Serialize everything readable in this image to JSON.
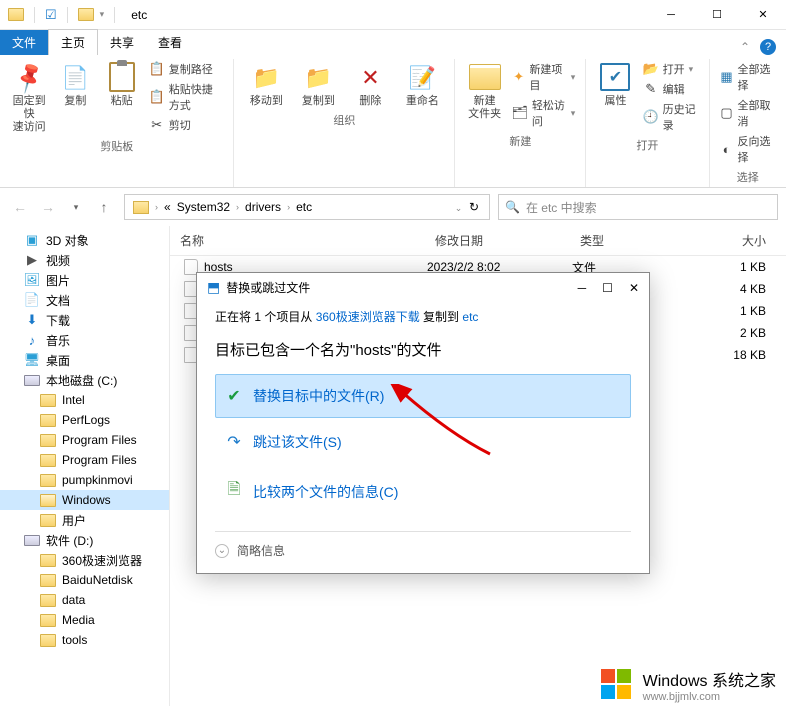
{
  "titlebar": {
    "title": "etc"
  },
  "tabs": {
    "file": "文件",
    "home": "主页",
    "share": "共享",
    "view": "查看"
  },
  "ribbon": {
    "clipboard": {
      "label": "剪贴板",
      "pin": "固定到快\n速访问",
      "copy": "复制",
      "paste": "粘贴",
      "copy_path": "复制路径",
      "paste_shortcut": "粘贴快捷方式",
      "cut": "剪切"
    },
    "organize": {
      "label": "组织",
      "move_to": "移动到",
      "copy_to": "复制到",
      "delete": "删除",
      "rename": "重命名"
    },
    "new": {
      "label": "新建",
      "new_folder": "新建\n文件夹",
      "new_item": "新建项目",
      "easy_access": "轻松访问"
    },
    "open": {
      "label": "打开",
      "properties": "属性",
      "open": "打开",
      "edit": "编辑",
      "history": "历史记录"
    },
    "select": {
      "label": "选择",
      "select_all": "全部选择",
      "select_none": "全部取消",
      "invert": "反向选择"
    }
  },
  "breadcrumb": {
    "items": [
      "System32",
      "drivers",
      "etc"
    ],
    "refresh": "⟳"
  },
  "search": {
    "placeholder": "在 etc 中搜索"
  },
  "tree": {
    "three_d": "3D 对象",
    "videos": "视频",
    "pictures": "图片",
    "documents": "文档",
    "downloads": "下载",
    "music": "音乐",
    "desktop": "桌面",
    "local_c": "本地磁盘 (C:)",
    "intel": "Intel",
    "perflogs": "PerfLogs",
    "program_files": "Program Files",
    "program_files2": "Program Files",
    "pumpkin": "pumpkinmovi",
    "windows": "Windows",
    "users": "用户",
    "soft_d": "软件 (D:)",
    "360": "360极速浏览器",
    "baidu": "BaiduNetdisk",
    "data": "data",
    "media": "Media",
    "tools": "tools"
  },
  "columns": {
    "name": "名称",
    "date": "修改日期",
    "type": "类型",
    "size": "大小"
  },
  "files": [
    {
      "name": "hosts",
      "date": "2023/2/2 8:02",
      "type": "文件",
      "size": "1 KB"
    },
    {
      "name": "",
      "date": "",
      "type": "",
      "size": "4 KB"
    },
    {
      "name": "",
      "date": "",
      "type": "",
      "size": "1 KB"
    },
    {
      "name": "",
      "date": "",
      "type": "",
      "size": "2 KB"
    },
    {
      "name": "",
      "date": "",
      "type": "",
      "size": "18 KB"
    }
  ],
  "dialog": {
    "title": "替换或跳过文件",
    "line1_a": "正在将 1 个项目从 ",
    "line1_link1": "360极速浏览器下载",
    "line1_b": " 复制到 ",
    "line1_link2": "etc",
    "line2": "目标已包含一个名为\"hosts\"的文件",
    "opt1": "替换目标中的文件(R)",
    "opt2": "跳过该文件(S)",
    "opt3": "比较两个文件的信息(C)",
    "more": "简略信息"
  },
  "watermark": {
    "title": "Windows",
    "sub": "系统之家",
    "url": "www.bjjmlv.com"
  }
}
